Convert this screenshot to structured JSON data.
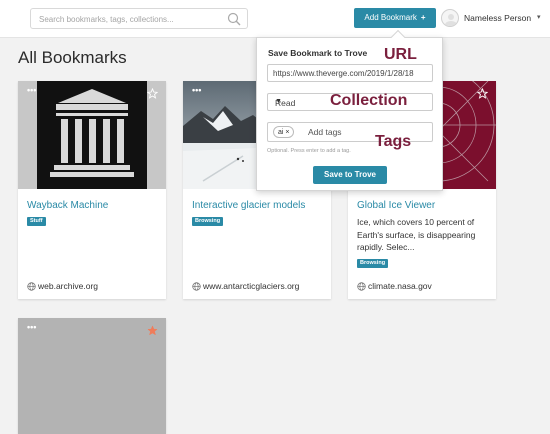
{
  "header": {
    "search_placeholder": "Search bookmarks, tags, collections...",
    "add_button_label": "Add Bookmark",
    "add_button_icon": "+",
    "username": "Nameless Person",
    "user_menu_caret": "▾"
  },
  "page": {
    "title": "All Bookmarks"
  },
  "cards": [
    {
      "title": "Wayback Machine",
      "tag": "Stuff",
      "description": "",
      "domain": "web.archive.org",
      "starred": false
    },
    {
      "title": "Interactive glacier models",
      "tag": "Browsing",
      "description": "",
      "domain": "www.antarcticglaciers.org",
      "starred": false
    },
    {
      "title": "Global Ice Viewer",
      "tag": "Browsing",
      "description": "Ice, which covers 10 percent of Earth's surface, is disappearing rapidly.  Selec...",
      "domain": "climate.nasa.gov",
      "starred": false
    },
    {
      "title": "",
      "tag": "",
      "description": "",
      "domain": "",
      "starred": true
    }
  ],
  "card_menu_label": "•••",
  "popup": {
    "title": "Save Bookmark to Trove",
    "url_value": "https://www.theverge.com/2019/1/28/18",
    "collection_value": "Read",
    "tag_chip": "ai ×",
    "tags_placeholder": "Add tags",
    "hint": "Optional. Press enter to add a tag.",
    "save_label": "Save to Trove"
  },
  "annotations": {
    "url": "URL",
    "collection": "Collection",
    "tags": "Tags"
  },
  "colors": {
    "accent": "#2a8aa6",
    "annotation": "#7a1f3d",
    "star_active": "#f07c5a"
  }
}
